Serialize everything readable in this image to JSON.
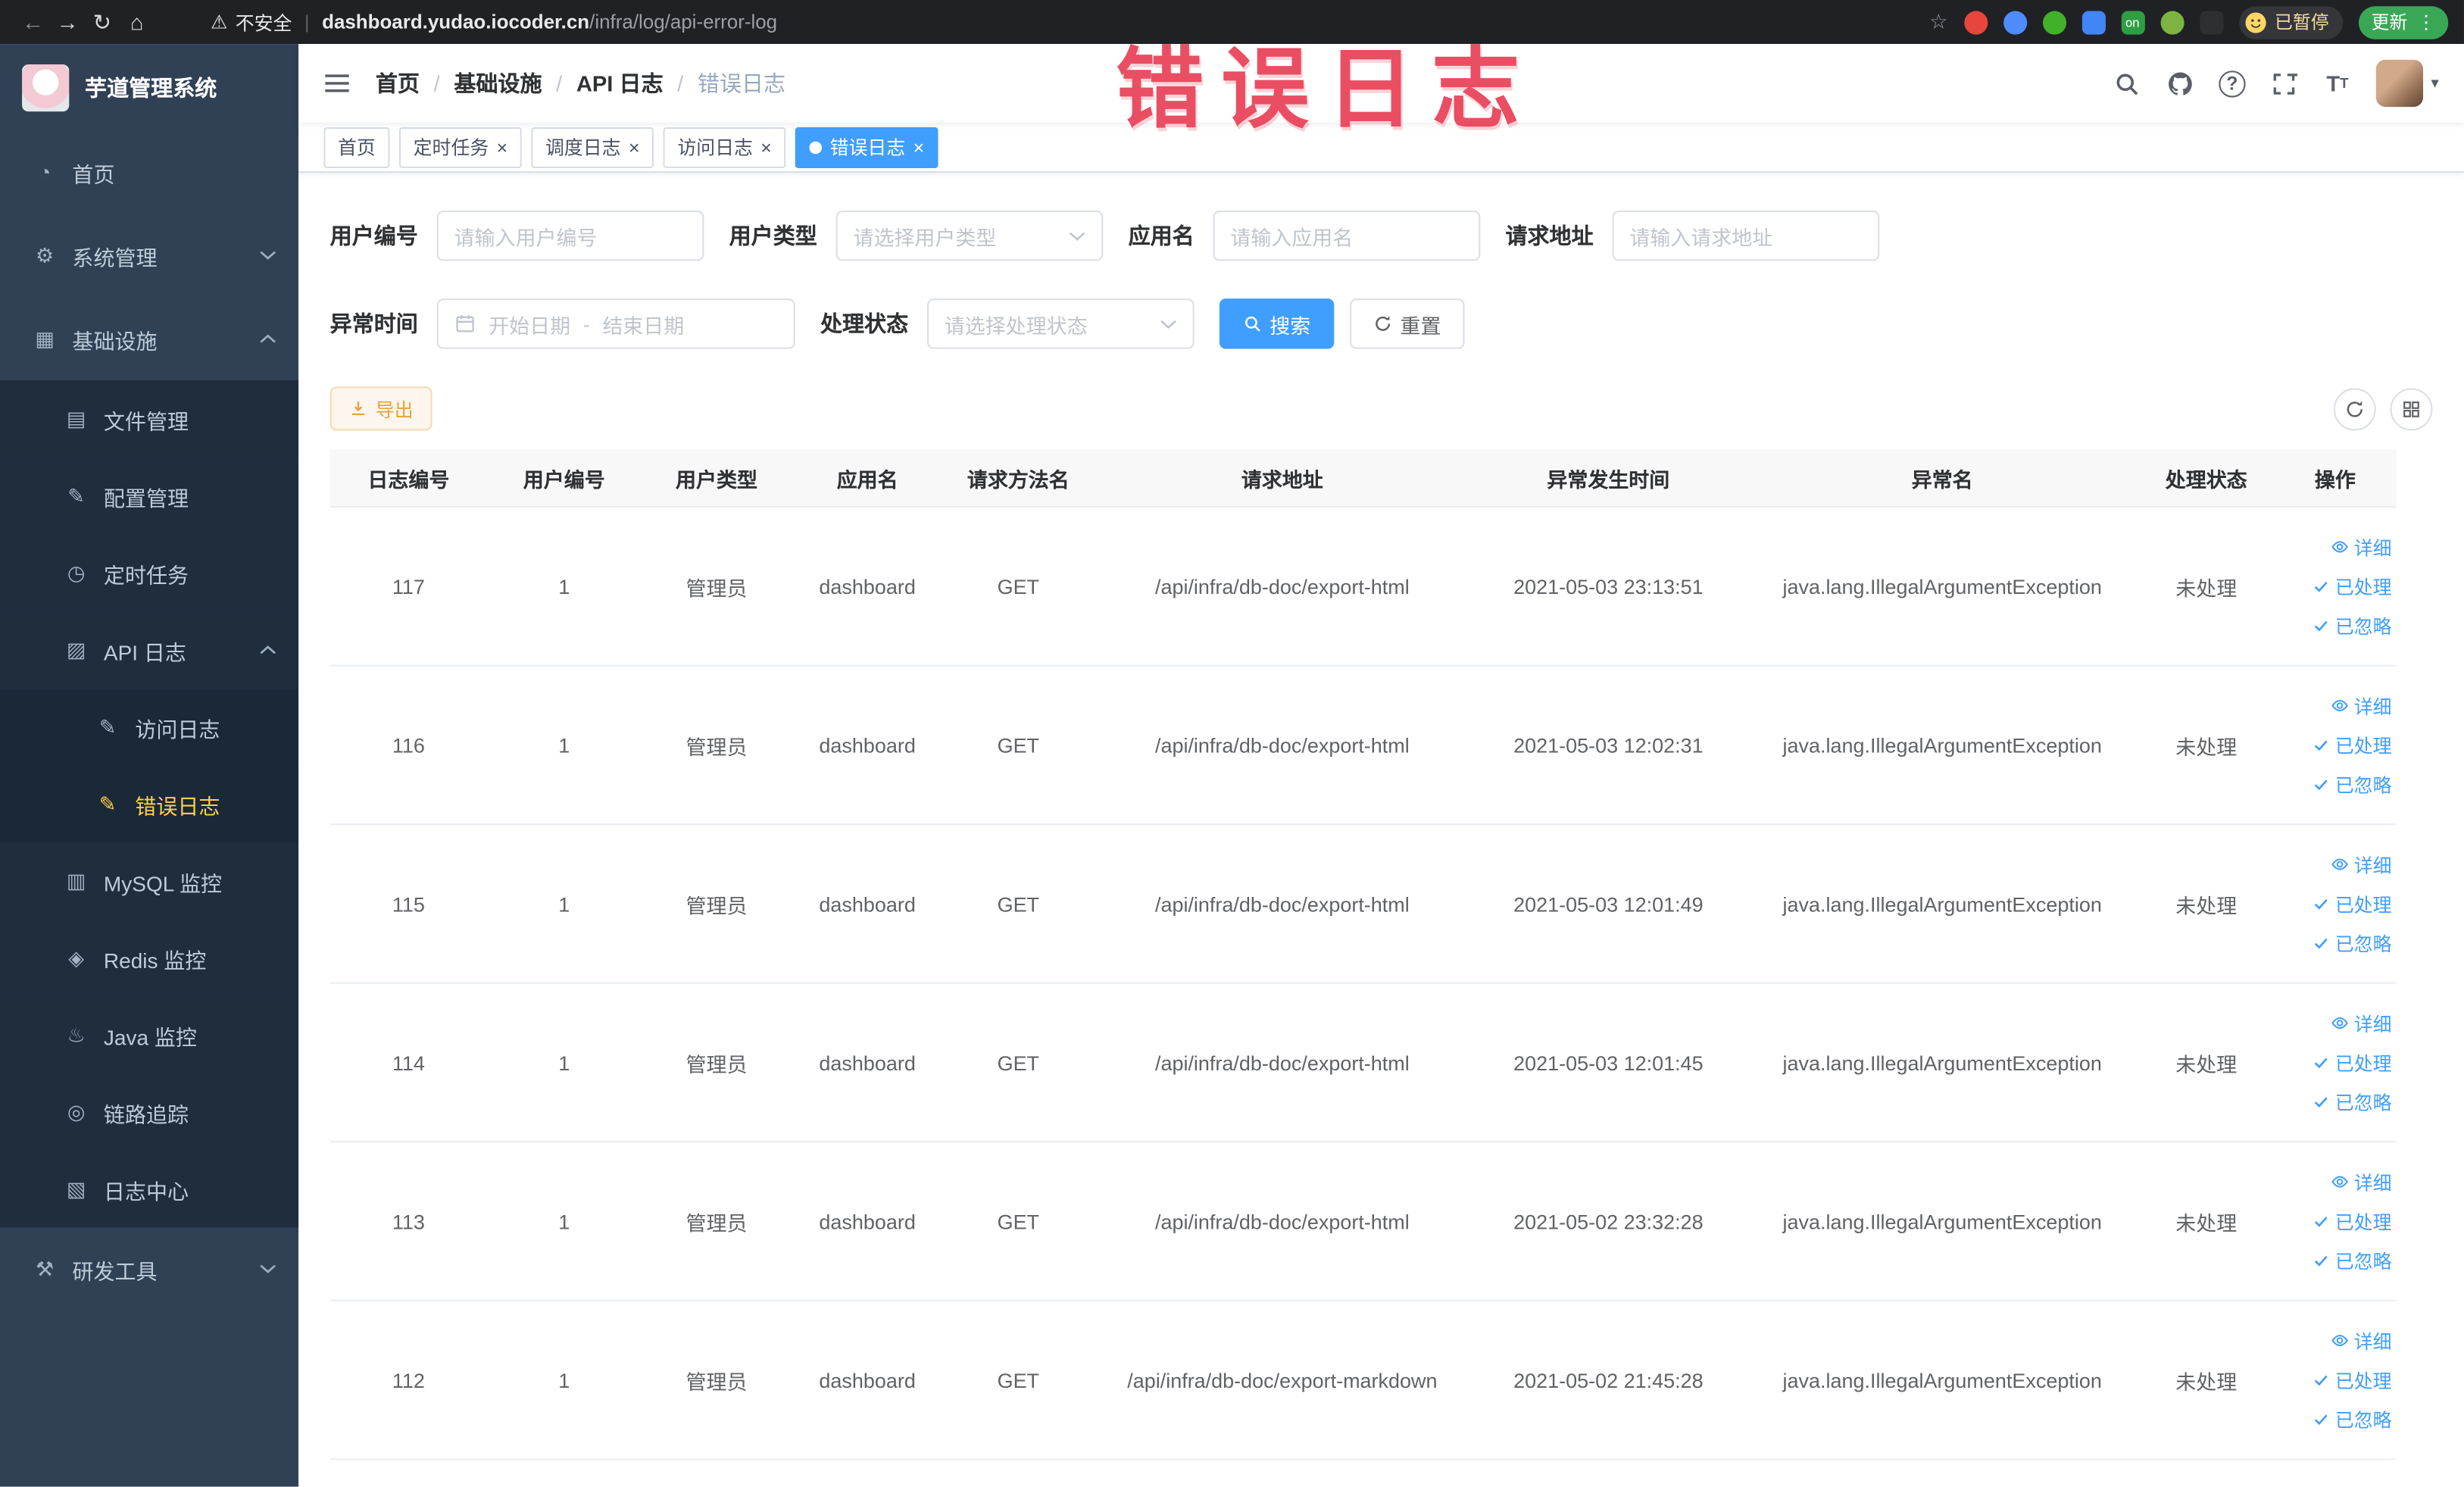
{
  "colors": {
    "primary": "#409eff",
    "sidebar_bg": "#304156",
    "sidebar_submenu_bg": "#1f2d3d",
    "active_menu_text": "#ffd04b",
    "warning": "#e6a23c",
    "annotation_red": "#e8435a",
    "chrome_bar": "#202124",
    "update_green": "#3aa757"
  },
  "annotation": {
    "text": "错误日志"
  },
  "browser": {
    "security_label": "不安全",
    "url_host": "dashboard.yudao.iocoder.cn",
    "url_path": "/infra/log/api-error-log",
    "extension_on_label": "on",
    "paused_badge": "已暂停",
    "update_label": "更新"
  },
  "sidebar": {
    "logo_title": "芋道管理系统",
    "items": [
      {
        "key": "home",
        "label": "首页",
        "icon": "dashboard-icon",
        "level": 1
      },
      {
        "key": "system",
        "label": "系统管理",
        "icon": "gear-icon",
        "level": 1,
        "arrow": "down"
      },
      {
        "key": "infra",
        "label": "基础设施",
        "icon": "infrastructure-icon",
        "level": 1,
        "arrow": "up"
      },
      {
        "key": "file",
        "label": "文件管理",
        "icon": "file-icon",
        "level": 2
      },
      {
        "key": "config",
        "label": "配置管理",
        "icon": "config-icon",
        "level": 2
      },
      {
        "key": "job",
        "label": "定时任务",
        "icon": "timer-icon",
        "level": 2
      },
      {
        "key": "api-log",
        "label": "API 日志",
        "icon": "api-log-icon",
        "level": 2,
        "arrow": "up"
      },
      {
        "key": "access-log",
        "label": "访问日志",
        "icon": "access-log-icon",
        "level": 3
      },
      {
        "key": "error-log",
        "label": "错误日志",
        "icon": "error-log-icon",
        "level": 3,
        "active": true
      },
      {
        "key": "mysql",
        "label": "MySQL 监控",
        "icon": "mysql-icon",
        "level": 2
      },
      {
        "key": "redis",
        "label": "Redis 监控",
        "icon": "redis-icon",
        "level": 2
      },
      {
        "key": "java",
        "label": "Java 监控",
        "icon": "java-icon",
        "level": 2
      },
      {
        "key": "trace",
        "label": "链路追踪",
        "icon": "trace-icon",
        "level": 2
      },
      {
        "key": "log-center",
        "label": "日志中心",
        "icon": "log-center-icon",
        "level": 2
      },
      {
        "key": "dev-tools",
        "label": "研发工具",
        "icon": "tools-icon",
        "level": 1,
        "arrow": "down"
      }
    ]
  },
  "breadcrumb": [
    "首页",
    "基础设施",
    "API 日志",
    "错误日志"
  ],
  "tabs": [
    {
      "label": "首页",
      "closable": false,
      "active": false
    },
    {
      "label": "定时任务",
      "closable": true,
      "active": false
    },
    {
      "label": "调度日志",
      "closable": true,
      "active": false
    },
    {
      "label": "访问日志",
      "closable": true,
      "active": false
    },
    {
      "label": "错误日志",
      "closable": true,
      "active": true
    }
  ],
  "filters": {
    "user_id": {
      "label": "用户编号",
      "placeholder": "请输入用户编号"
    },
    "user_type": {
      "label": "用户类型",
      "placeholder": "请选择用户类型"
    },
    "app_name": {
      "label": "应用名",
      "placeholder": "请输入应用名"
    },
    "request_url": {
      "label": "请求地址",
      "placeholder": "请输入请求地址"
    },
    "exception_time": {
      "label": "异常时间",
      "start_placeholder": "开始日期",
      "separator": "-",
      "end_placeholder": "结束日期"
    },
    "process_status": {
      "label": "处理状态",
      "placeholder": "请选择处理状态"
    },
    "search_label": "搜索",
    "reset_label": "重置"
  },
  "toolbar": {
    "export_label": "导出"
  },
  "table": {
    "columns": [
      "日志编号",
      "用户编号",
      "用户类型",
      "应用名",
      "请求方法名",
      "请求地址",
      "异常发生时间",
      "异常名",
      "处理状态",
      "操作"
    ],
    "row_actions": [
      "详细",
      "已处理",
      "已忽略"
    ],
    "rows": [
      {
        "log_id": "117",
        "user_id": "1",
        "user_type": "管理员",
        "app_name": "dashboard",
        "method": "GET",
        "request_url": "/api/infra/db-doc/export-html",
        "time": "2021-05-03 23:13:51",
        "exception": "java.lang.IllegalArgumentException",
        "status": "未处理"
      },
      {
        "log_id": "116",
        "user_id": "1",
        "user_type": "管理员",
        "app_name": "dashboard",
        "method": "GET",
        "request_url": "/api/infra/db-doc/export-html",
        "time": "2021-05-03 12:02:31",
        "exception": "java.lang.IllegalArgumentException",
        "status": "未处理"
      },
      {
        "log_id": "115",
        "user_id": "1",
        "user_type": "管理员",
        "app_name": "dashboard",
        "method": "GET",
        "request_url": "/api/infra/db-doc/export-html",
        "time": "2021-05-03 12:01:49",
        "exception": "java.lang.IllegalArgumentException",
        "status": "未处理"
      },
      {
        "log_id": "114",
        "user_id": "1",
        "user_type": "管理员",
        "app_name": "dashboard",
        "method": "GET",
        "request_url": "/api/infra/db-doc/export-html",
        "time": "2021-05-03 12:01:45",
        "exception": "java.lang.IllegalArgumentException",
        "status": "未处理"
      },
      {
        "log_id": "113",
        "user_id": "1",
        "user_type": "管理员",
        "app_name": "dashboard",
        "method": "GET",
        "request_url": "/api/infra/db-doc/export-html",
        "time": "2021-05-02 23:32:28",
        "exception": "java.lang.IllegalArgumentException",
        "status": "未处理"
      },
      {
        "log_id": "112",
        "user_id": "1",
        "user_type": "管理员",
        "app_name": "dashboard",
        "method": "GET",
        "request_url": "/api/infra/db-doc/export-markdown",
        "time": "2021-05-02 21:45:28",
        "exception": "java.lang.IllegalArgumentException",
        "status": "未处理"
      }
    ]
  }
}
